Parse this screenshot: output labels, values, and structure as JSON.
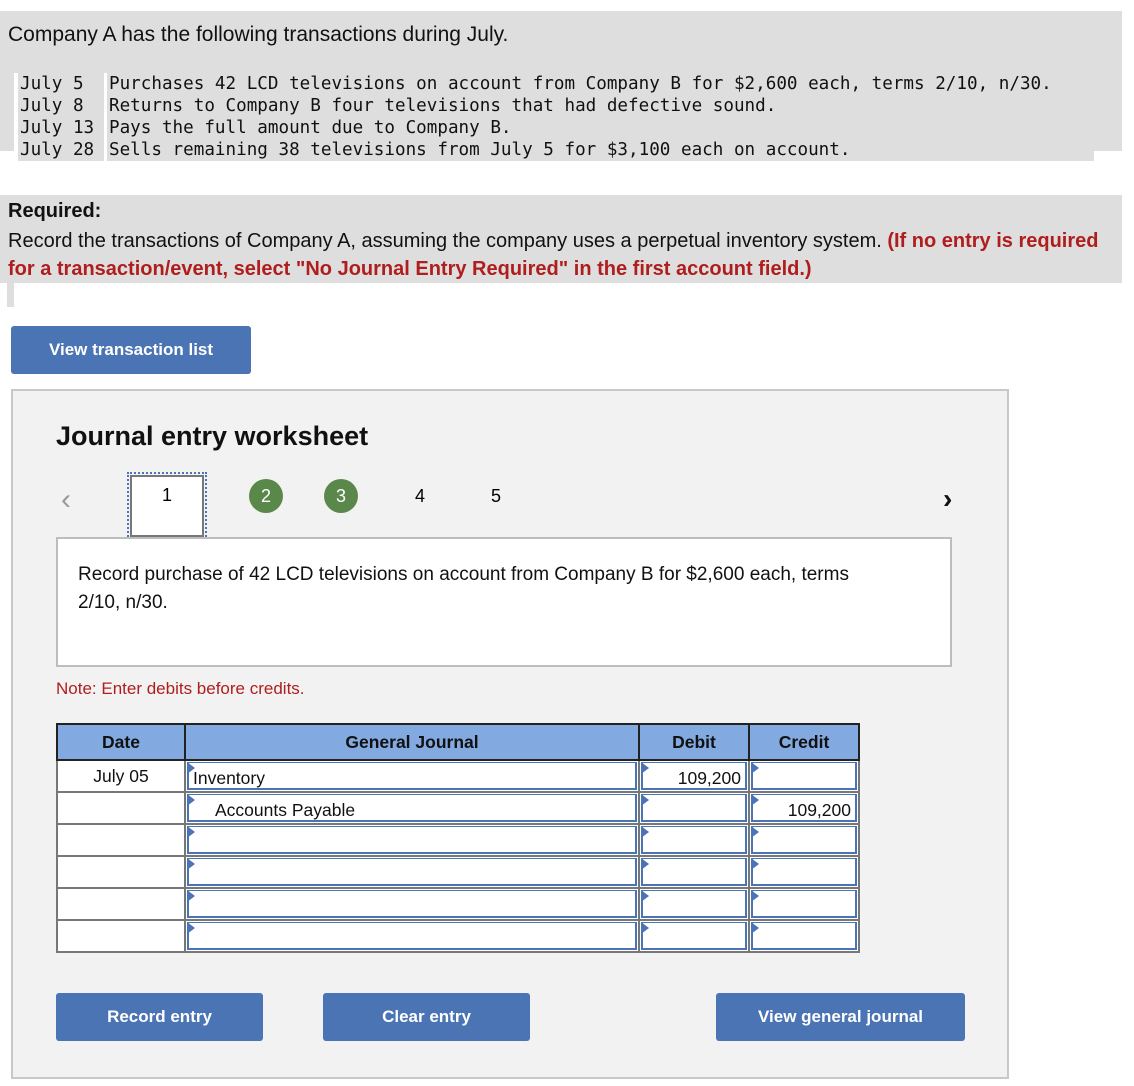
{
  "problem": {
    "intro": "Company A has the following transactions during July.",
    "transactions": [
      {
        "date": "July 5",
        "description": "Purchases 42 LCD televisions on account from Company B for $2,600 each, terms 2/10, n/30."
      },
      {
        "date": "July 8",
        "description": "Returns to Company B four televisions that had defective sound."
      },
      {
        "date": "July 13",
        "description": "Pays the full amount due to Company B."
      },
      {
        "date": "July 28",
        "description": "Sells remaining 38 televisions from July 5 for $3,100 each on account."
      }
    ]
  },
  "required": {
    "label": "Required:",
    "text": "Record the transactions of Company A, assuming the company uses a perpetual inventory system.",
    "instruction": "(If no entry is required for a transaction/event, select \"No Journal Entry Required\" in the first account field.)"
  },
  "buttons": {
    "view_transaction_list": "View transaction list",
    "record_entry": "Record entry",
    "clear_entry": "Clear entry",
    "view_general_journal": "View general journal"
  },
  "worksheet": {
    "title": "Journal entry worksheet",
    "nav": {
      "prev_icon": "chevron-left-icon",
      "next_icon": "chevron-right-icon",
      "prev": "<",
      "next": ">"
    },
    "steps": [
      {
        "label": "1",
        "state": "current"
      },
      {
        "label": "2",
        "state": "completed"
      },
      {
        "label": "3",
        "state": "completed"
      },
      {
        "label": "4",
        "state": "pending"
      },
      {
        "label": "5",
        "state": "pending"
      }
    ],
    "description": "Record purchase of 42 LCD televisions on account from Company B for $2,600 each, terms 2/10, n/30.",
    "note": "Note: Enter debits before credits.",
    "columns": {
      "date": "Date",
      "account": "General Journal",
      "debit": "Debit",
      "credit": "Credit"
    },
    "rows": [
      {
        "date": "July 05",
        "account": "Inventory",
        "debit": "109,200",
        "credit": ""
      },
      {
        "date": "",
        "account": "Accounts Payable",
        "debit": "",
        "credit": "109,200"
      },
      {
        "date": "",
        "account": "",
        "debit": "",
        "credit": ""
      },
      {
        "date": "",
        "account": "",
        "debit": "",
        "credit": ""
      },
      {
        "date": "",
        "account": "",
        "debit": "",
        "credit": ""
      },
      {
        "date": "",
        "account": "",
        "debit": "",
        "credit": ""
      }
    ]
  },
  "colors": {
    "button_blue": "#4b74b4",
    "header_blue": "#82a9e0",
    "step_done_green": "#5a874a",
    "instruction_red": "#b01d1d"
  }
}
